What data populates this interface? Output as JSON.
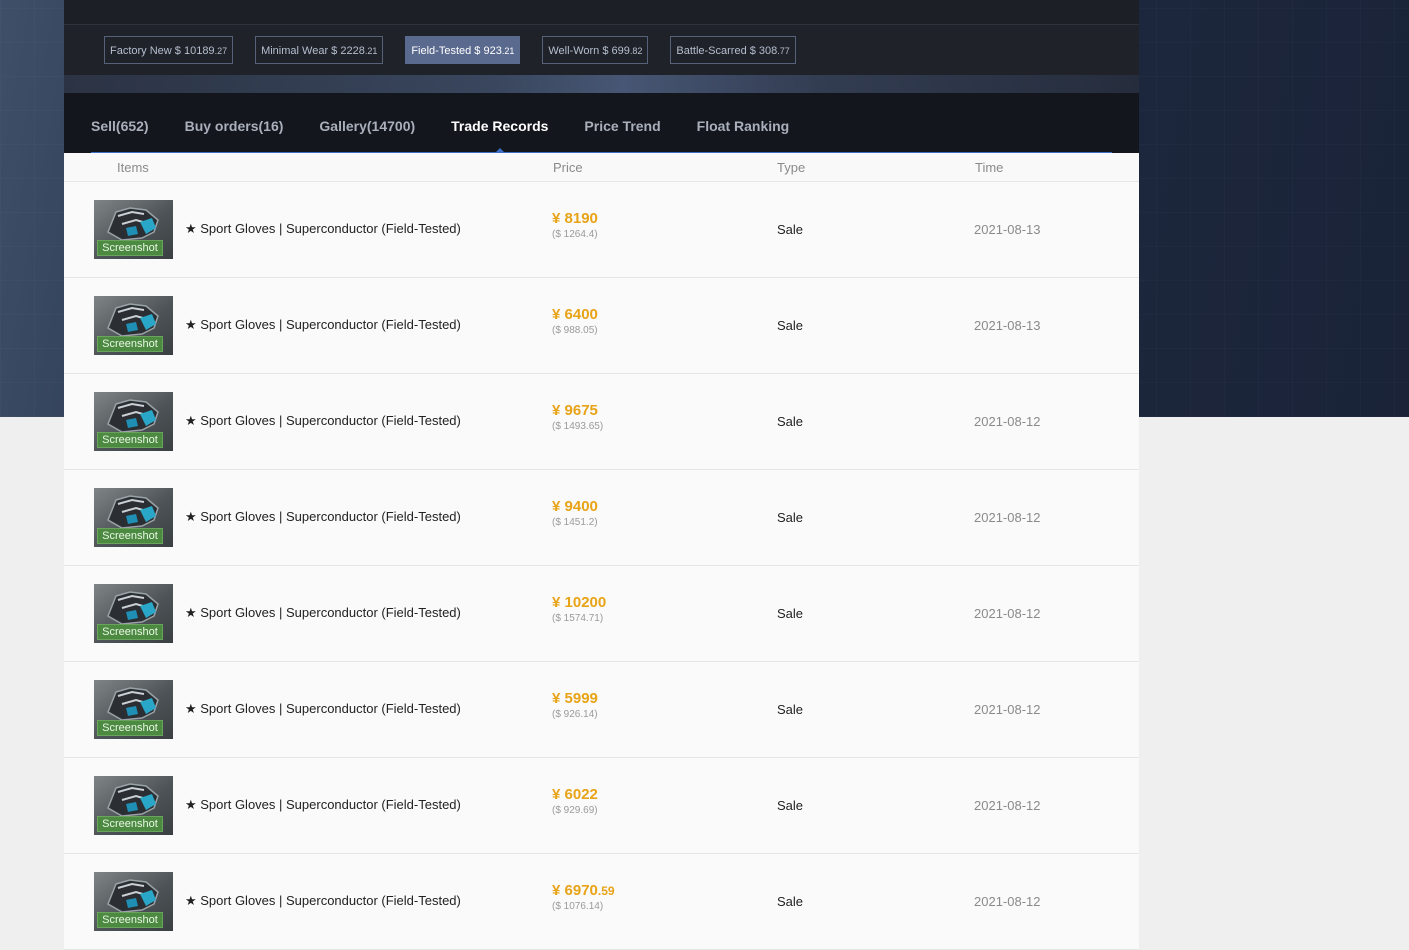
{
  "wear_options": [
    {
      "label": "Factory New $ 10189",
      "cents": ".27",
      "active": false
    },
    {
      "label": "Minimal Wear $ 2228",
      "cents": ".21",
      "active": false
    },
    {
      "label": "Field-Tested $ 923",
      "cents": ".21",
      "active": true
    },
    {
      "label": "Well-Worn $ 699",
      "cents": ".82",
      "active": false
    },
    {
      "label": "Battle-Scarred $ 308",
      "cents": ".77",
      "active": false
    }
  ],
  "tabs": [
    {
      "label": "Sell(652)",
      "active": false
    },
    {
      "label": "Buy orders(16)",
      "active": false
    },
    {
      "label": "Gallery(14700)",
      "active": false
    },
    {
      "label": "Trade Records",
      "active": true
    },
    {
      "label": "Price Trend",
      "active": false
    },
    {
      "label": "Float Ranking",
      "active": false
    }
  ],
  "table": {
    "headers": {
      "items": "Items",
      "price": "Price",
      "type": "Type",
      "time": "Time"
    },
    "screenshot_label": "Screenshot",
    "rows": [
      {
        "name": "★ Sport Gloves | Superconductor (Field-Tested)",
        "cny": "¥ 8190",
        "cny_dec": "",
        "usd": "($ 1264.4)",
        "type": "Sale",
        "time": "2021-08-13"
      },
      {
        "name": "★ Sport Gloves | Superconductor (Field-Tested)",
        "cny": "¥ 6400",
        "cny_dec": "",
        "usd": "($ 988.05)",
        "type": "Sale",
        "time": "2021-08-13"
      },
      {
        "name": "★ Sport Gloves | Superconductor (Field-Tested)",
        "cny": "¥ 9675",
        "cny_dec": "",
        "usd": "($ 1493.65)",
        "type": "Sale",
        "time": "2021-08-12"
      },
      {
        "name": "★ Sport Gloves | Superconductor (Field-Tested)",
        "cny": "¥ 9400",
        "cny_dec": "",
        "usd": "($ 1451.2)",
        "type": "Sale",
        "time": "2021-08-12"
      },
      {
        "name": "★ Sport Gloves | Superconductor (Field-Tested)",
        "cny": "¥ 10200",
        "cny_dec": "",
        "usd": "($ 1574.71)",
        "type": "Sale",
        "time": "2021-08-12"
      },
      {
        "name": "★ Sport Gloves | Superconductor (Field-Tested)",
        "cny": "¥ 5999",
        "cny_dec": "",
        "usd": "($ 926.14)",
        "type": "Sale",
        "time": "2021-08-12"
      },
      {
        "name": "★ Sport Gloves | Superconductor (Field-Tested)",
        "cny": "¥ 6022",
        "cny_dec": "",
        "usd": "($ 929.69)",
        "type": "Sale",
        "time": "2021-08-12"
      },
      {
        "name": "★ Sport Gloves | Superconductor (Field-Tested)",
        "cny": "¥ 6970",
        "cny_dec": ".59",
        "usd": "($ 1076.14)",
        "type": "Sale",
        "time": "2021-08-12"
      }
    ]
  },
  "colors": {
    "accent_price": "#e8a317",
    "active_wear": "#5a6a8e",
    "tab_underline": "#3c6fc4",
    "screenshot_badge": "#4c8a41"
  },
  "icons": {
    "item_thumbnail": "gloves-icon"
  }
}
